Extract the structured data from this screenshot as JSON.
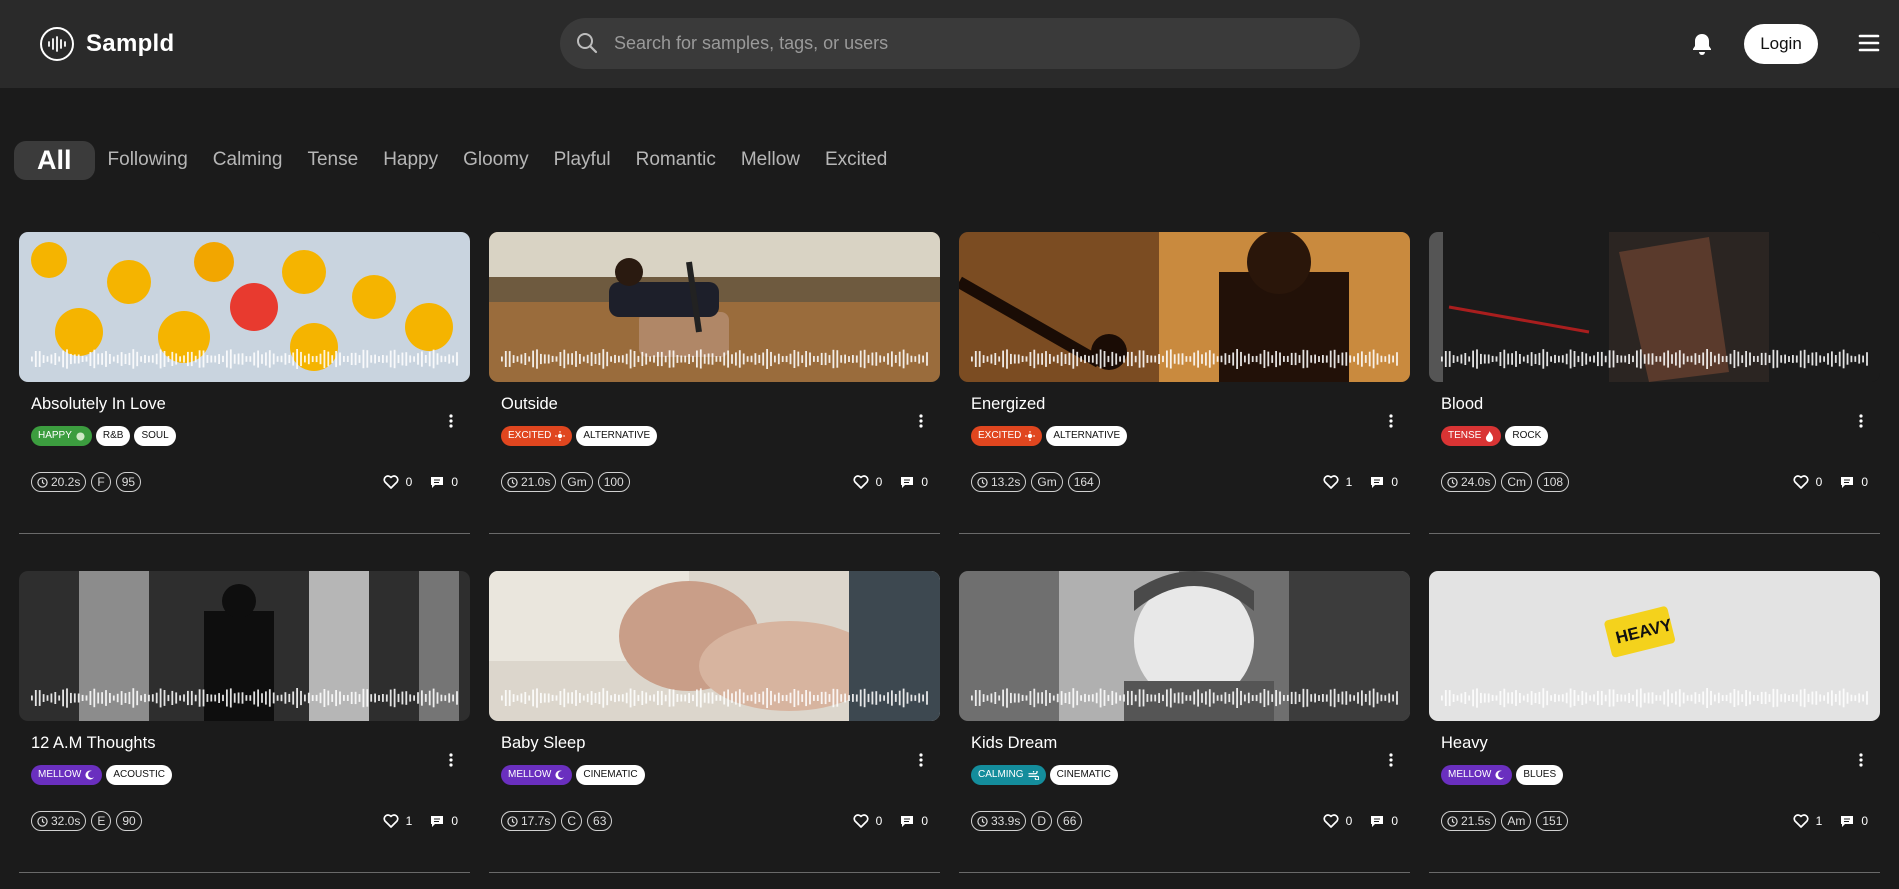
{
  "app": {
    "name": "Sampld"
  },
  "header": {
    "search_placeholder": "Search for samples, tags, or users",
    "login_label": "Login"
  },
  "filters": [
    "All",
    "Following",
    "Calming",
    "Tense",
    "Happy",
    "Gloomy",
    "Playful",
    "Romantic",
    "Mellow",
    "Excited"
  ],
  "active_filter": "All",
  "mood_colors": {
    "HAPPY": "#3c9d3f",
    "EXCITED": "#e0461f",
    "TENSE": "#d93434",
    "MELLOW": "#6a2fbf",
    "CALMING": "#148d9c"
  },
  "mood_icons": {
    "HAPPY": "circle-icon",
    "EXCITED": "sun-icon",
    "TENSE": "flame-icon",
    "MELLOW": "moon-icon",
    "CALMING": "wind-icon"
  },
  "samples": [
    {
      "title": "Absolutely In Love",
      "mood": "HAPPY",
      "tags": [
        "R&B",
        "SOUL"
      ],
      "duration": "20.2s",
      "key": "F",
      "bpm": "95",
      "likes": "0",
      "comments": "0",
      "image": "emoji-faces"
    },
    {
      "title": "Outside",
      "mood": "EXCITED",
      "tags": [
        "ALTERNATIVE"
      ],
      "duration": "21.0s",
      "key": "Gm",
      "bpm": "100",
      "likes": "0",
      "comments": "0",
      "image": "guitarist-in-field"
    },
    {
      "title": "Energized",
      "mood": "EXCITED",
      "tags": [
        "ALTERNATIVE"
      ],
      "duration": "13.2s",
      "key": "Gm",
      "bpm": "164",
      "likes": "1",
      "comments": "0",
      "image": "guitarist-on-stage"
    },
    {
      "title": "Blood",
      "mood": "TENSE",
      "tags": [
        "ROCK"
      ],
      "duration": "24.0s",
      "key": "Cm",
      "bpm": "108",
      "likes": "0",
      "comments": "0",
      "image": "dark-syringe"
    },
    {
      "title": "12 A.M Thoughts",
      "mood": "MELLOW",
      "tags": [
        "ACOUSTIC"
      ],
      "duration": "32.0s",
      "key": "E",
      "bpm": "90",
      "likes": "1",
      "comments": "0",
      "image": "silhouette-window"
    },
    {
      "title": "Baby Sleep",
      "mood": "MELLOW",
      "tags": [
        "CINEMATIC"
      ],
      "duration": "17.7s",
      "key": "C",
      "bpm": "63",
      "likes": "0",
      "comments": "0",
      "image": "sleeping-baby"
    },
    {
      "title": "Kids Dream",
      "mood": "CALMING",
      "tags": [
        "CINEMATIC"
      ],
      "duration": "33.9s",
      "key": "D",
      "bpm": "66",
      "likes": "0",
      "comments": "0",
      "image": "smiling-child"
    },
    {
      "title": "Heavy",
      "mood": "MELLOW",
      "tags": [
        "BLUES"
      ],
      "duration": "21.5s",
      "key": "Am",
      "bpm": "151",
      "likes": "1",
      "comments": "0",
      "image": "heavy-sticker"
    }
  ]
}
